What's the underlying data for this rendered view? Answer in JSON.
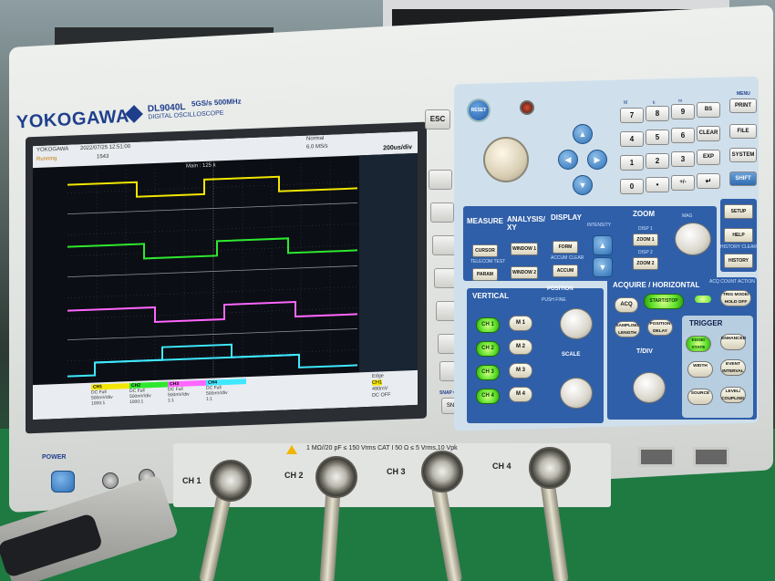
{
  "instrument": {
    "brand": "YOKOGAWA",
    "model": "DL9040L",
    "model_sub": "DIGITAL OSCILLOSCOPE",
    "spec": "5GS/s 500MHz",
    "power_label": "POWER",
    "esc_label": "ESC",
    "snap_clear_label": "SNAP CLEAR",
    "snap_label": "SNAP",
    "connector_spec": "1 MΩ//20 pF ≤ 150 Vrms  CAT I  50 Ω ≤ 5 Vrms,10 Vpk",
    "channels": [
      "CH 1",
      "CH 2",
      "CH 3",
      "CH 4"
    ]
  },
  "screen": {
    "logo": "YOKOGAWA",
    "datetime": "2022/07/25 12:51:00",
    "state": "Running",
    "count": "1543",
    "mode": "Normal",
    "sample_rate": "6.0 MS/s",
    "time_div": "200us/div",
    "main_label": "Main : 125 k",
    "channel_info": [
      {
        "name": "CH1",
        "coupling": "DC Full",
        "volts": "500mV/div",
        "probe": "1000:1",
        "color": "#f2e600"
      },
      {
        "name": "CH2",
        "coupling": "DC Full",
        "volts": "500mV/div",
        "probe": "1000:1",
        "color": "#2ee82e"
      },
      {
        "name": "CH3",
        "coupling": "DC Full",
        "volts": "500mV/div",
        "probe": "1:1",
        "color": "#ff66ff"
      },
      {
        "name": "CH4",
        "coupling": "DC Full",
        "volts": "500mV/div",
        "probe": "1:1",
        "color": "#3fe8ff"
      }
    ],
    "trigger": {
      "type": "Edge",
      "source": "CH1",
      "level": "490mV",
      "coupling": "DC OFF"
    }
  },
  "panel": {
    "reset": "RESET",
    "keypad": {
      "row1": [
        "7",
        "8",
        "9",
        "BS"
      ],
      "row1_sub": [
        "M",
        "k",
        "m",
        "μ"
      ],
      "row2": [
        "4",
        "5",
        "6",
        "CLEAR"
      ],
      "row2_sub": [
        "G",
        "T",
        "P",
        "n"
      ],
      "row3": [
        "1",
        "2",
        "3",
        "EXP"
      ],
      "row3_sub": [
        "E",
        "F",
        "A",
        "B"
      ],
      "row4": [
        "0",
        "•",
        "+/-",
        "↵"
      ]
    },
    "menu_label": "MENU",
    "function_keys": [
      "PRINT",
      "FILE",
      "SYSTEM",
      "SHIFT"
    ],
    "measure": {
      "title": "MEASURE",
      "cursor": "CURSOR",
      "telecom": "TELECOM TEST",
      "param": "PARAM"
    },
    "analysis": {
      "title": "ANALYSIS/ XY",
      "window1": "WINDOW 1",
      "window2": "WINDOW 2"
    },
    "display": {
      "title": "DISPLAY",
      "intensity": "INTENSITY",
      "form": "FORM",
      "accum_clear": "ACCUM CLEAR",
      "accum": "ACCUM"
    },
    "zoom": {
      "title": "ZOOM",
      "mag": "MAG",
      "disp1": "DISP 1",
      "zoom1": "ZOOM 1",
      "disp2": "DISP 2",
      "zoom2": "ZOOM 2"
    },
    "setup_keys": {
      "setup": "SETUP",
      "help": "HELP",
      "history_clear": "HISTORY CLEAR",
      "history": "HISTORY"
    },
    "vertical": {
      "title": "VERTICAL",
      "position": "POSITION",
      "push_fine": "PUSH  FINE",
      "scale": "SCALE",
      "ch": [
        "CH 1",
        "CH 2",
        "CH 3",
        "CH 4"
      ],
      "m": [
        "M 1",
        "M 2",
        "M 3",
        "M 4"
      ]
    },
    "acquire": {
      "title": "ACQUIRE / HORIZONTAL",
      "acq_count": "ACQ COUNT ACTION",
      "acq": "ACQ",
      "start_stop": "START/STOP",
      "trig_mode": "TRIG MODE/ HOLD OFF",
      "sampling_length": "SAMPLING LENGTH",
      "position_delay": "POSITION DELAY",
      "tdiv": "T/DIV"
    },
    "trigger": {
      "title": "TRIGGER",
      "edge_state": "EDGE/ STATE",
      "enhanced": "ENHANCED",
      "width": "WIDTH",
      "event_interval": "EVENT INTERVAL",
      "source": "SOURCE",
      "level_coupling": "LEVEL/ COUPLING"
    }
  }
}
